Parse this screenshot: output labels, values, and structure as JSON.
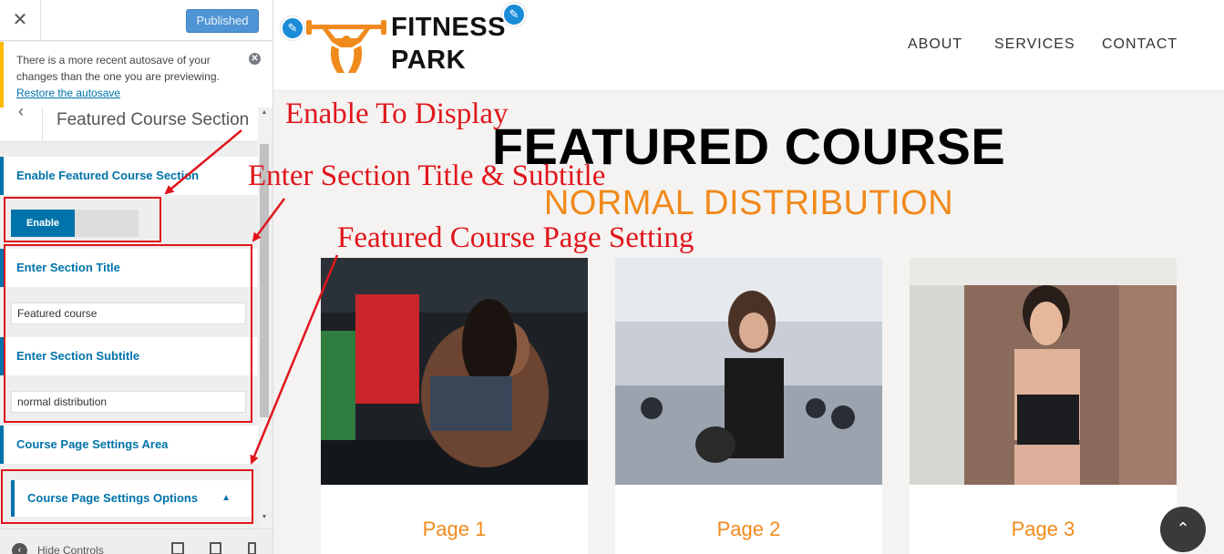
{
  "customizer": {
    "close_glyph": "✕",
    "publish_label": "Published",
    "notice": {
      "text": "There is a more recent autosave of your changes than the one you are previewing.",
      "link": "Restore the autosave",
      "dismiss_glyph": "✕"
    },
    "section_back_glyph": "‹",
    "section_title": "Featured Course Section",
    "scroll_up_glyph": "▲",
    "scroll_down_glyph": "▼",
    "controls": {
      "enable_label": "Enable Featured Course Section",
      "enable_toggle": "Enable",
      "title_label": "Enter Section Title",
      "title_value": "Featured course",
      "subtitle_label": "Enter Section Subtitle",
      "subtitle_value": "normal distribution",
      "page_settings_label": "Course Page Settings Area",
      "options_label": "Course Page Settings Options",
      "options_caret": "▲"
    },
    "footer": {
      "hide_label": "Hide Controls",
      "hide_glyph": "‹"
    }
  },
  "annotations": {
    "enable": "Enable To Display",
    "title_subtitle": "Enter Section Title & Subtitle",
    "page_setting": "Featured Course Page Setting"
  },
  "site": {
    "edit_glyph": "✎",
    "logo_line1": "FITNESS",
    "logo_line2": "PARK",
    "nav": [
      "ABOUT",
      "SERVICES",
      "CONTACT"
    ],
    "featured_title": "FEATURED COURSE",
    "featured_subtitle": "NORMAL DISTRIBUTION",
    "cards": [
      {
        "title": "Page 1"
      },
      {
        "title": "Page 2"
      },
      {
        "title": "Page 3"
      }
    ],
    "scroll_top_glyph": "⌃"
  },
  "colors": {
    "wp_blue": "#0073aa",
    "annotation_red": "#e0161c",
    "accent_orange": "#f08a1c"
  }
}
